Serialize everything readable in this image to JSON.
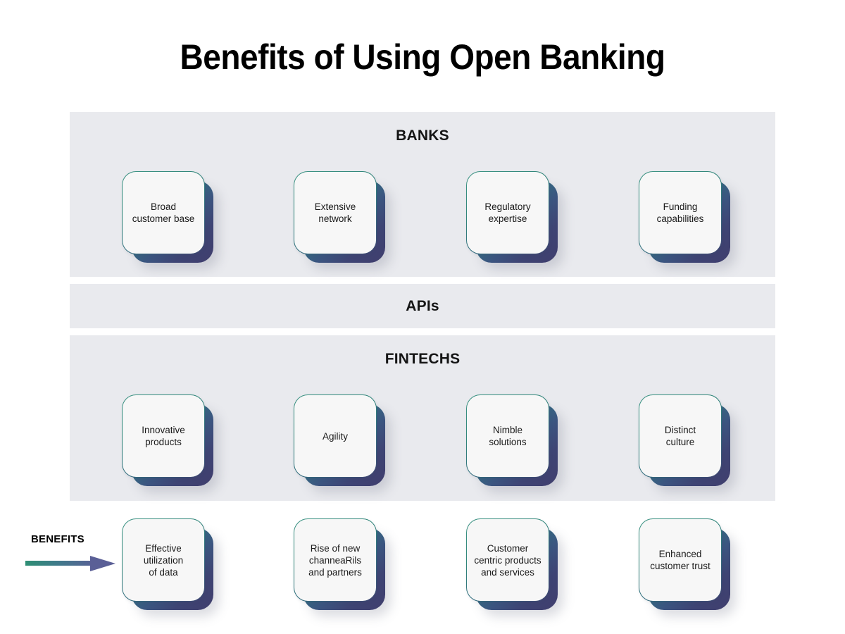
{
  "title": "Benefits of Using Open Banking",
  "colors": {
    "band_background": "#e9eaee",
    "gradient_start_teal": "#349083",
    "gradient_end_indigo": "#403e6d",
    "card_face": "#f7f7f7",
    "text": "#111111"
  },
  "sections": [
    {
      "id": "banks",
      "heading": "BANKS",
      "cards": [
        {
          "label": "Broad\ncustomer base"
        },
        {
          "label": "Extensive\nnetwork"
        },
        {
          "label": "Regulatory\nexpertise"
        },
        {
          "label": "Funding\ncapabilities"
        }
      ]
    },
    {
      "id": "apis",
      "heading": "APIs",
      "cards": []
    },
    {
      "id": "fintechs",
      "heading": "FINTECHS",
      "cards": [
        {
          "label": "Innovative\nproducts"
        },
        {
          "label": "Agility"
        },
        {
          "label": "Nimble\nsolutions"
        },
        {
          "label": "Distinct\nculture"
        }
      ]
    }
  ],
  "benefits": {
    "callout_label": "BENEFITS",
    "arrow_icon": "arrow-right-icon",
    "cards": [
      {
        "label": "Effective\nutilization\nof data"
      },
      {
        "label": "Rise of new\nchanneaRils\nand partners"
      },
      {
        "label": "Customer\ncentric products\nand services"
      },
      {
        "label": "Enhanced\ncustomer trust"
      }
    ]
  }
}
